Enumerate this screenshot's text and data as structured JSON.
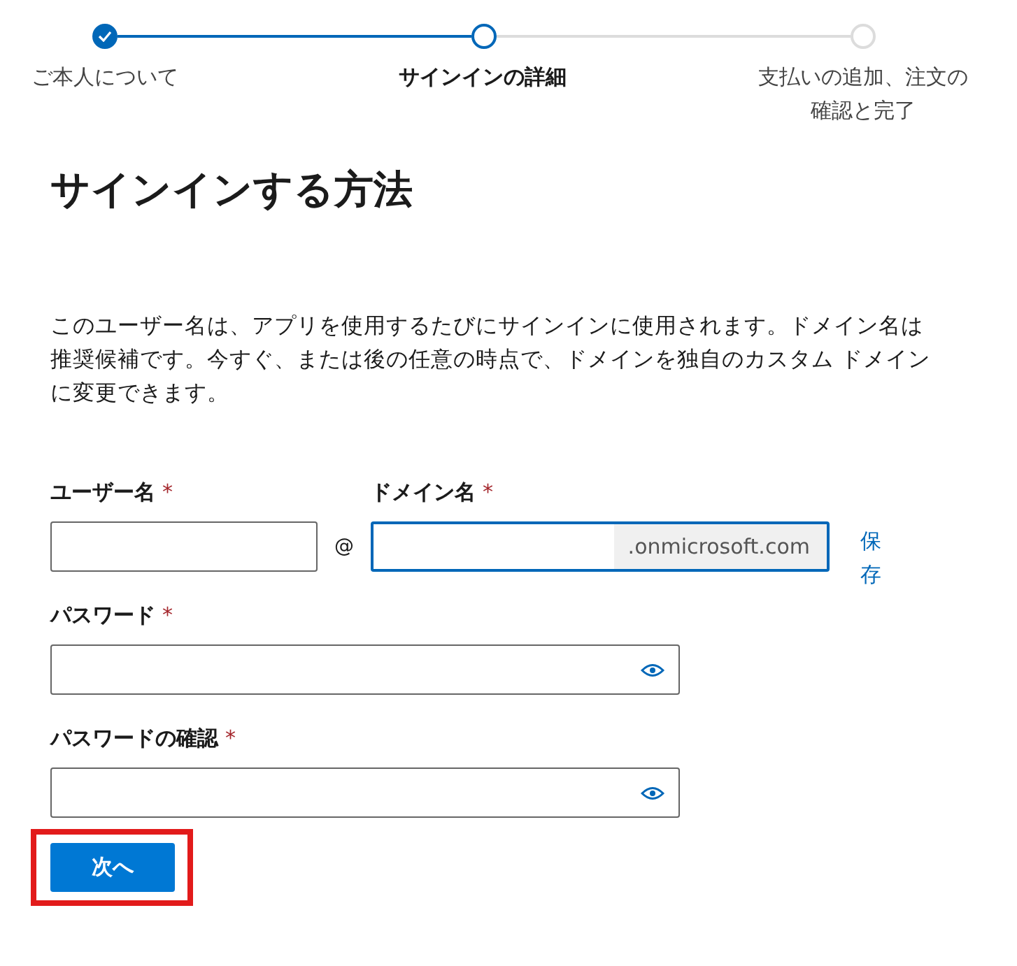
{
  "stepper": [
    {
      "label": "ご本人について",
      "completed": true,
      "selected": false
    },
    {
      "label": "サインインの詳細",
      "completed": false,
      "selected": true
    },
    {
      "label": "支払いの追加、注文の確認と完了",
      "completed": false,
      "selected": false
    }
  ],
  "heading": "サインインする方法",
  "description": "このユーザー名は、アプリを使用するたびにサインインに使用されます。ドメイン名は推奨候補です。今すぐ、または後の任意の時点で、ドメインを独自のカスタム ドメインに変更できます。",
  "account": {
    "username": {
      "label": "ユーザー名",
      "asterisk": "*",
      "focused": false
    },
    "separator": "@",
    "domain": {
      "label": "ドメイン名",
      "asterisk": "*",
      "focused": true,
      "suffix": ".onmicrosoft.com"
    },
    "save_link": "保存"
  },
  "passwords": [
    {
      "label": "パスワード",
      "asterisk": "*",
      "focused": false,
      "kind": "password"
    },
    {
      "label": "パスワードの確認",
      "asterisk": "*",
      "focused": false,
      "kind": "password"
    }
  ],
  "next_button": {
    "label": "次へ",
    "highlighted": true
  }
}
